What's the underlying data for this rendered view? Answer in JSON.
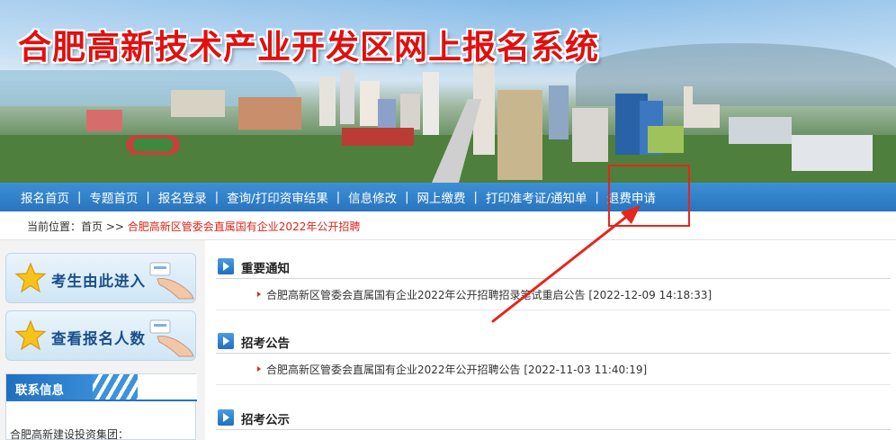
{
  "banner": {
    "title": "合肥高新技术产业开发区网上报名系统"
  },
  "nav": {
    "items": [
      {
        "label": "报名首页"
      },
      {
        "label": "专题首页"
      },
      {
        "label": "报名登录"
      },
      {
        "label": "查询/打印资审结果"
      },
      {
        "label": "信息修改"
      },
      {
        "label": "网上缴费"
      },
      {
        "label": "打印准考证/通知单"
      },
      {
        "label": "退费申请"
      }
    ],
    "separator": "|"
  },
  "breadcrumb": {
    "prefix": "当前位置：",
    "home": "首页",
    "arrow": ">>",
    "current": "合肥高新区管委会直属国有企业2022年公开招聘"
  },
  "sidebar": {
    "enter_button": "考生由此进入",
    "count_button": "查看报名人数",
    "contact_title": "联系信息",
    "contact_org": "合肥高新建设投资集团："
  },
  "sections": {
    "notice": {
      "title": "重要通知",
      "items": [
        {
          "text": "合肥高新区管委会直属国有企业2022年公开招聘招录笔试重启公告 [2022-12-09 14:18:33]"
        }
      ]
    },
    "announce": {
      "title": "招考公告",
      "items": [
        {
          "text": "合肥高新区管委会直属国有企业2022年公开招聘公告 [2022-11-03 11:40:19]"
        }
      ]
    },
    "publicity": {
      "title": "招考公示"
    }
  },
  "colors": {
    "nav_blue": "#2a74bd",
    "title_red": "#e01010",
    "annotation_red": "#e8241c",
    "breadcrumb_current": "#d9261c"
  },
  "icons": {
    "star": "star-icon",
    "hand": "pointing-hand-icon",
    "section_arrow": "arrow-right-icon",
    "item_bullet": "triangle-bullet-icon"
  }
}
